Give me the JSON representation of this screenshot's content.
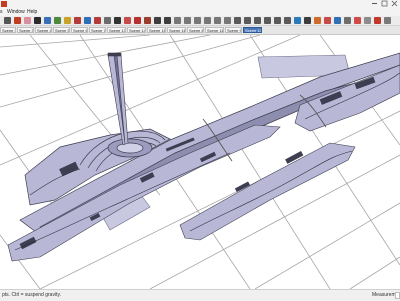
{
  "menu": {
    "items": [
      "s",
      "Window",
      "Help"
    ]
  },
  "toolbar": {
    "tools": [
      {
        "icon": "select-arrow-icon",
        "color": "#555555"
      },
      {
        "icon": "pencil-icon",
        "color": "#c23b22"
      },
      {
        "icon": "eraser-icon",
        "color": "#d98fa0"
      },
      {
        "icon": "line-icon",
        "color": "#2b2b2b"
      },
      {
        "icon": "arc-icon",
        "color": "#3a6fb7"
      },
      {
        "icon": "push-pull-icon",
        "color": "#4d8a3a"
      },
      {
        "icon": "offset-icon",
        "color": "#c9a227"
      },
      {
        "icon": "move-icon",
        "color": "#b53a3a"
      },
      {
        "icon": "rotate-icon",
        "color": "#2f6fb5"
      },
      {
        "icon": "scale-icon",
        "color": "#b53a3a"
      },
      {
        "icon": "tape-measure-icon",
        "color": "#6b6b6b"
      },
      {
        "icon": "text-icon",
        "color": "#333333"
      },
      {
        "icon": "paint-bucket-icon",
        "color": "#c64a4a"
      },
      {
        "icon": "orbit-icon",
        "color": "#b5302f"
      },
      {
        "icon": "pan-icon",
        "color": "#9a3d2f"
      },
      {
        "icon": "zoom-icon",
        "color": "#3d3d3d"
      },
      {
        "icon": "zoom-extents-icon",
        "color": "#3d3d3d"
      },
      {
        "icon": "iso-view-icon",
        "color": "#777777"
      },
      {
        "icon": "top-view-icon",
        "color": "#777777"
      },
      {
        "icon": "front-view-icon",
        "color": "#777777"
      },
      {
        "icon": "right-view-icon",
        "color": "#777777"
      },
      {
        "icon": "back-view-icon",
        "color": "#777777"
      },
      {
        "icon": "left-view-icon",
        "color": "#777777"
      },
      {
        "icon": "xray-icon",
        "color": "#5a5a5a"
      },
      {
        "icon": "wireframe-icon",
        "color": "#5a5a5a"
      },
      {
        "icon": "hidden-line-icon",
        "color": "#5a5a5a"
      },
      {
        "icon": "shaded-icon",
        "color": "#5a5a5a"
      },
      {
        "icon": "textured-icon",
        "color": "#5a5a5a"
      },
      {
        "icon": "monochrome-icon",
        "color": "#5a5a5a"
      },
      {
        "icon": "section-plane-icon",
        "color": "#2a7bb8"
      },
      {
        "icon": "shadow-icon",
        "color": "#3d3d3d"
      },
      {
        "icon": "fog-icon",
        "color": "#d06a2a"
      },
      {
        "icon": "styles-icon",
        "color": "#c64a4a"
      },
      {
        "icon": "layers-icon",
        "color": "#2f6fb5"
      },
      {
        "icon": "components-icon",
        "color": "#6d6d6d"
      },
      {
        "icon": "materials-icon",
        "color": "#d04a4a"
      },
      {
        "icon": "sandbox-icon",
        "color": "#8c8c8c"
      },
      {
        "icon": "warehouse-icon",
        "color": "#c0392b"
      },
      {
        "icon": "extension-icon",
        "color": "#7a7a7a"
      }
    ]
  },
  "scenes": {
    "tabs": [
      {
        "label": "Scene 2",
        "active": false
      },
      {
        "label": "Scene 3",
        "active": false
      },
      {
        "label": "Scene 4",
        "active": false
      },
      {
        "label": "Scene 5",
        "active": false
      },
      {
        "label": "Scene 6",
        "active": false
      },
      {
        "label": "Scene 7",
        "active": false
      },
      {
        "label": "Scene 13",
        "active": false
      },
      {
        "label": "Scene 14",
        "active": false
      },
      {
        "label": "Scene 15",
        "active": false
      },
      {
        "label": "Scene 16",
        "active": false
      },
      {
        "label": "Scene 8",
        "active": false
      },
      {
        "label": "Scene 11",
        "active": false
      },
      {
        "label": "Scene 9",
        "active": false
      },
      {
        "label": "Scene 10",
        "active": true
      }
    ]
  },
  "status": {
    "hint": "pts. Ctrl = suspend gravity.",
    "measurements_label": "Measurements"
  },
  "colors": {
    "ground": "#ffffff",
    "road_lines": "#a6a6a6",
    "site_fill": "#b8b8d6",
    "site_outline": "#3d3d4f",
    "dark_detail": "#3e3e52",
    "pale_block": "#c8c8e0",
    "tab_active": "#4a79b8"
  }
}
